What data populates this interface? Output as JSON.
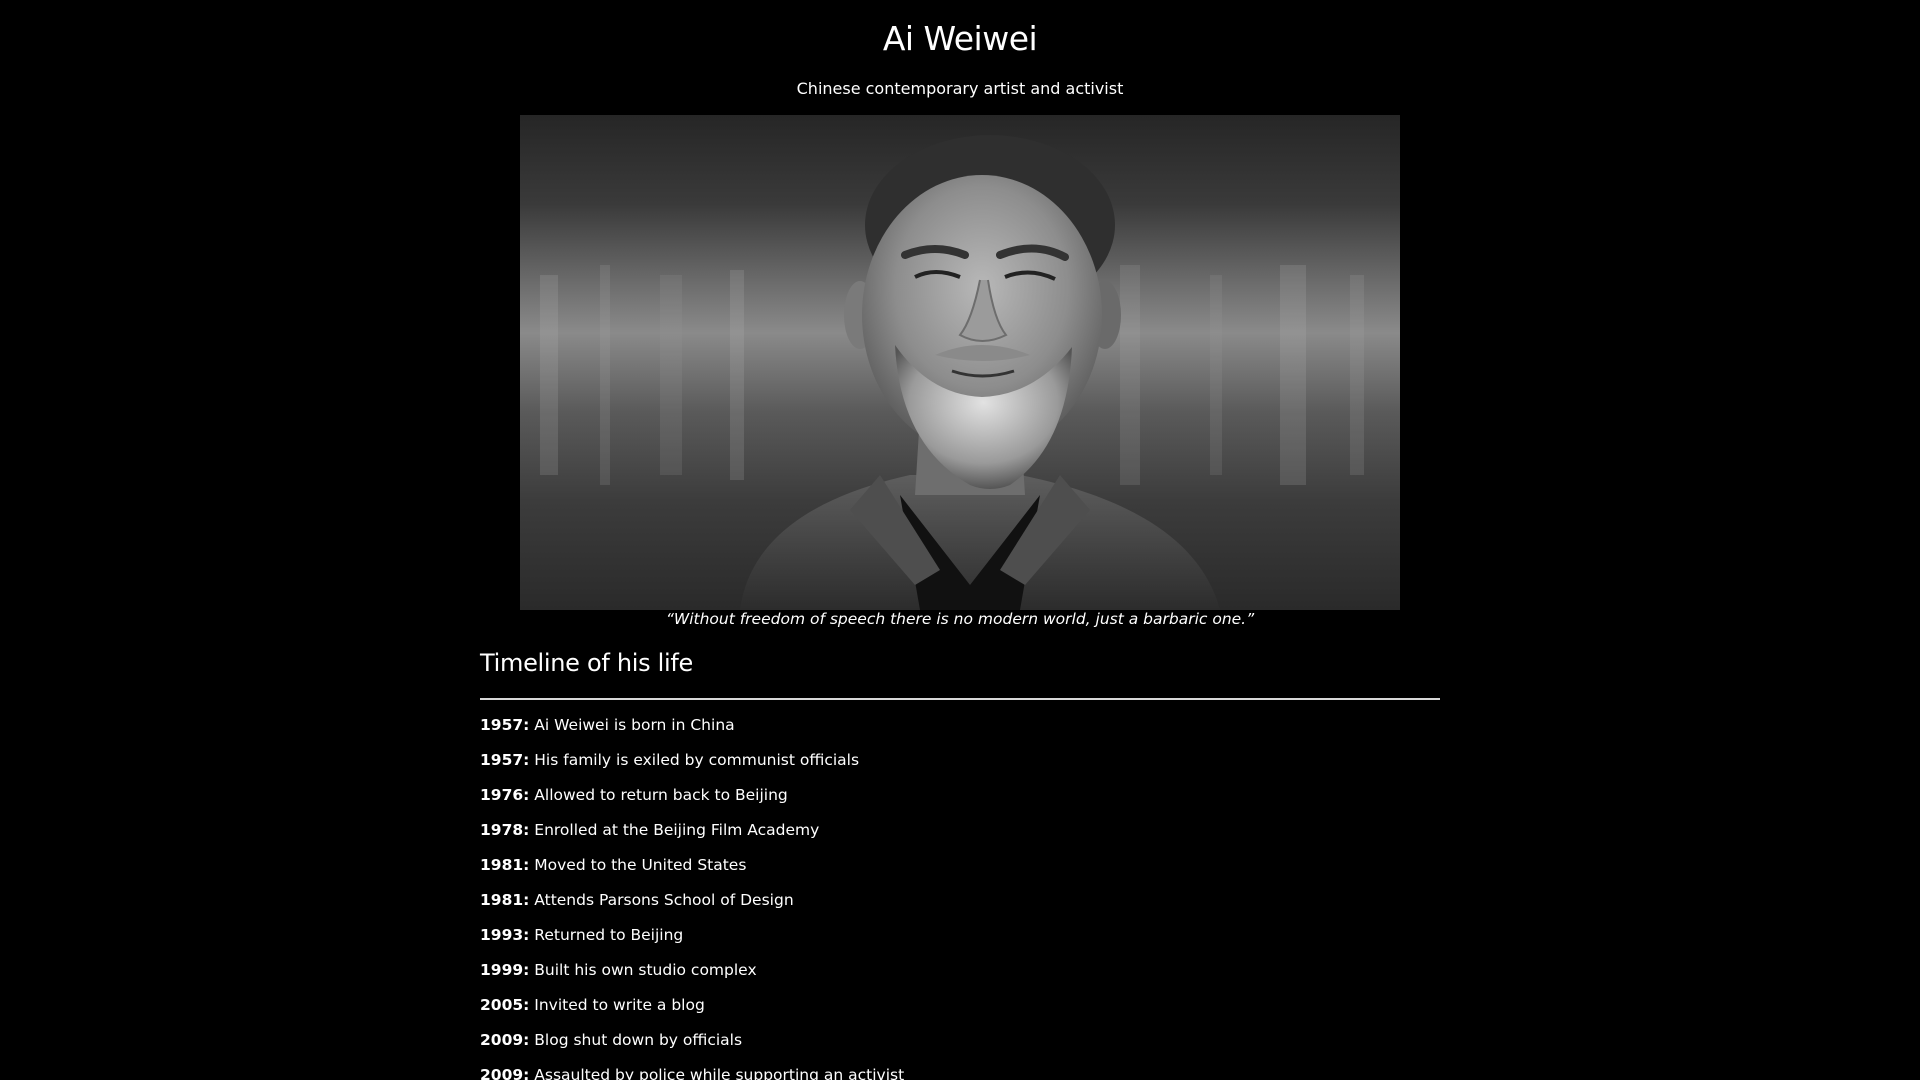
{
  "header": {
    "title": "Ai Weiwei",
    "subtitle": "Chinese contemporary artist and activist"
  },
  "portrait": {
    "image_icon": "portrait-photo-of-ai-weiwei",
    "caption": "“Without freedom of speech there is no modern world, just a barbaric one.”"
  },
  "timeline": {
    "heading": "Timeline of his life",
    "items": [
      {
        "year": "1957:",
        "text": "Ai Weiwei is born in China"
      },
      {
        "year": "1957:",
        "text": "His family is exiled by communist officials"
      },
      {
        "year": "1976:",
        "text": "Allowed to return back to Beijing"
      },
      {
        "year": "1978:",
        "text": "Enrolled at the Beijing Film Academy"
      },
      {
        "year": "1981:",
        "text": "Moved to the United States"
      },
      {
        "year": "1981:",
        "text": "Attends Parsons School of Design"
      },
      {
        "year": "1993:",
        "text": "Returned to Beijing"
      },
      {
        "year": "1999:",
        "text": "Built his own studio complex"
      },
      {
        "year": "2005:",
        "text": "Invited to write a blog"
      },
      {
        "year": "2009:",
        "text": "Blog shut down by officials"
      },
      {
        "year": "2009:",
        "text": "Assaulted by police while supporting an activist"
      }
    ]
  }
}
